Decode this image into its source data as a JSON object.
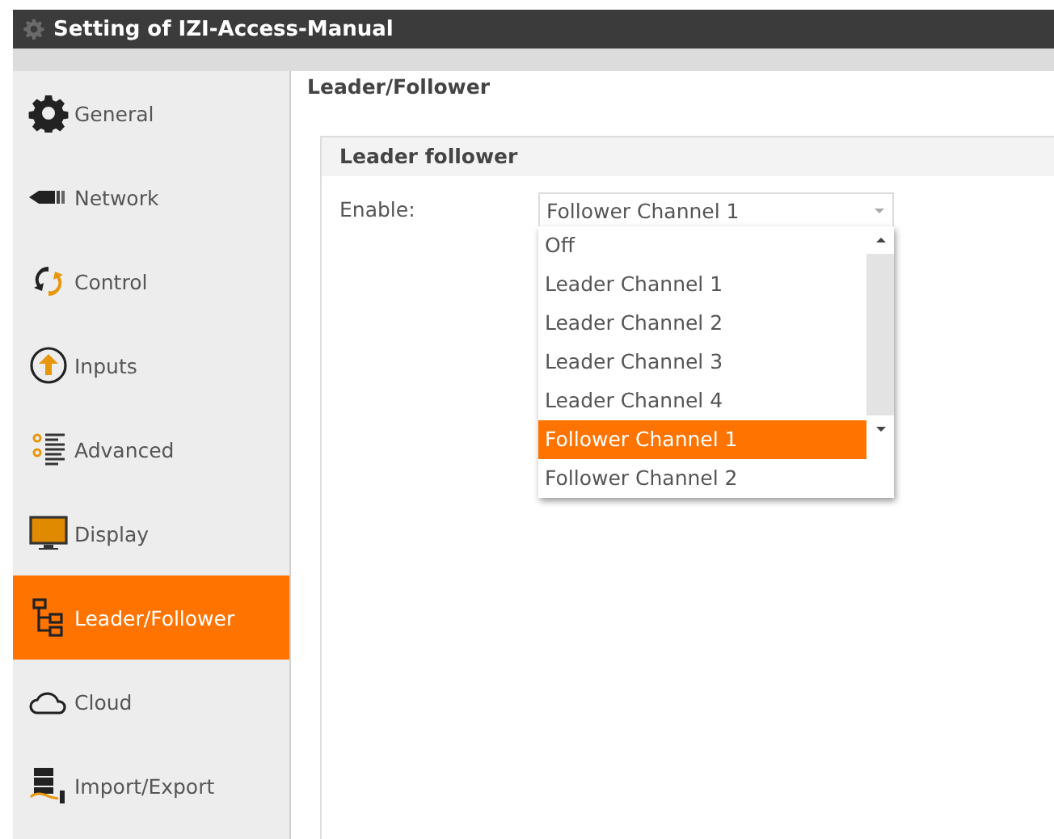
{
  "window": {
    "title": "Setting of IZI-Access-Manual"
  },
  "sidebar": {
    "items": [
      {
        "label": "General",
        "selected": false
      },
      {
        "label": "Network",
        "selected": false
      },
      {
        "label": "Control",
        "selected": false
      },
      {
        "label": "Inputs",
        "selected": false
      },
      {
        "label": "Advanced",
        "selected": false
      },
      {
        "label": "Display",
        "selected": false
      },
      {
        "label": "Leader/Follower",
        "selected": true
      },
      {
        "label": "Cloud",
        "selected": false
      },
      {
        "label": "Import/Export",
        "selected": false
      }
    ]
  },
  "page": {
    "title": "Leader/Follower"
  },
  "panel": {
    "title": "Leader follower",
    "fields": [
      {
        "label": "Enable:",
        "value": "Follower Channel 1",
        "expanded": true,
        "options": [
          {
            "label": "Off",
            "selected": false
          },
          {
            "label": "Leader Channel 1",
            "selected": false
          },
          {
            "label": "Leader Channel 2",
            "selected": false
          },
          {
            "label": "Leader Channel 3",
            "selected": false
          },
          {
            "label": "Leader Channel 4",
            "selected": false
          },
          {
            "label": "Follower Channel 1",
            "selected": true
          },
          {
            "label": "Follower Channel 2",
            "selected": false
          }
        ]
      }
    ]
  }
}
